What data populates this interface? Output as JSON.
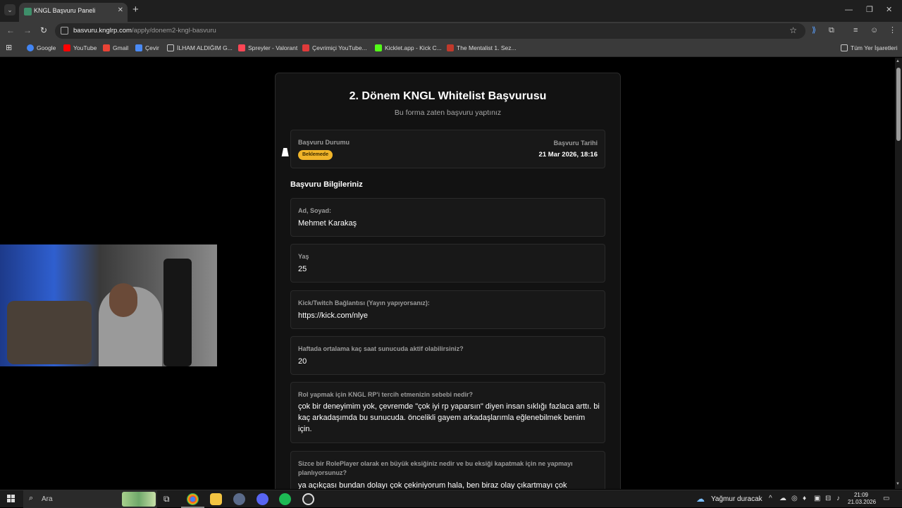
{
  "browser": {
    "tab_title": "KNGL Başvuru Paneli",
    "tab_close": "✕",
    "new_tab": "+",
    "url_host": "basvuru.knglrp.com",
    "url_path": "/apply/donem2-kngl-basvuru",
    "bookmarks": [
      {
        "label": "Google",
        "color": "#4285f4"
      },
      {
        "label": "YouTube",
        "color": "#ff0000"
      },
      {
        "label": "Gmail",
        "color": "#ea4335"
      },
      {
        "label": "Çevir",
        "color": "#4a8af4"
      },
      {
        "label": "İLHAM ALDIĞIM G...",
        "color": "#c8c8c8"
      },
      {
        "label": "Spreyler - Valorant",
        "color": "#ff4655"
      },
      {
        "label": "Çevrimiçi YouTube...",
        "color": "#e03a3a"
      },
      {
        "label": "Kicklet.app - Kick C...",
        "color": "#53fc18"
      },
      {
        "label": "The Mentalist 1. Sez...",
        "color": "#c0392b"
      }
    ],
    "all_bookmarks": "Tüm Yer İşaretleri"
  },
  "form": {
    "title": "2. Dönem KNGL Whitelist Başvurusu",
    "subtitle": "Bu forma zaten başvuru yaptınız",
    "status_label": "Başvuru Durumu",
    "status_value": "Beklemede",
    "status_color": "#f0b429",
    "date_label": "Başvuru Tarihi",
    "date_value": "21 Mar 2026, 18:16",
    "section_title": "Başvuru Bilgileriniz",
    "fields": [
      {
        "label": "Ad, Soyad:",
        "value": "Mehmet Karakaş"
      },
      {
        "label": "Yaş",
        "value": "25"
      },
      {
        "label": "Kick/Twitch Bağlantısı (Yayın yapıyorsanız):",
        "value": "https://kick.com/nlye"
      },
      {
        "label": "Haftada ortalama kaç saat sunucuda aktif olabilirsiniz?",
        "value": "20"
      },
      {
        "label": "Rol yapmak için KNGL RP'i tercih etmenizin sebebi nedir?",
        "value": "çok bir deneyimim yok, çevremde \"çok iyi rp yaparsın\" diyen insan sıklığı fazlaca arttı. bi kaç arkadaşımda bu sunucuda. öncelikli gayem arkadaşlarımla eğlenebilmek benim için."
      },
      {
        "label": "Sizce bir RolePlayer olarak en büyük eksiğiniz nedir ve bu eksiği kapatmak için ne yapmayı planlıyorsunuz?",
        "value": "ya açıkçası bundan dolayı çok çekiniyorum hala, ben biraz olay çıkartmayı çok"
      }
    ]
  },
  "taskbar": {
    "search_placeholder": "Ara",
    "weather": "Yağmur duracak",
    "time": "21:09",
    "date": "21.03.2026"
  }
}
